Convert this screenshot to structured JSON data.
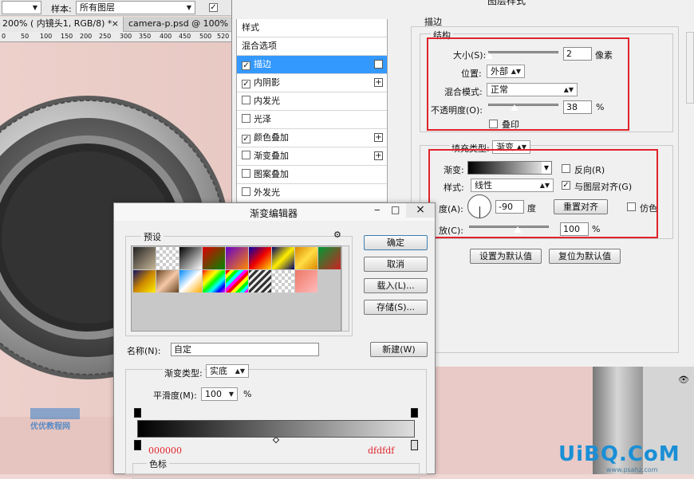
{
  "toolbar": {
    "first_dropdown": "",
    "sample_label": "样本:",
    "sample_value": "所有图层"
  },
  "tabs": [
    {
      "label": "200% ( 内镜头1, RGB/8) *"
    },
    {
      "label": "camera-p.psd @ 100% ("
    }
  ],
  "ruler": [
    "0",
    "50",
    "100",
    "150",
    "200",
    "250",
    "300",
    "350",
    "400",
    "450",
    "500",
    "520"
  ],
  "layer_style": {
    "title": "图层样式",
    "styles_header": "样式",
    "items": [
      {
        "label": "混合选项",
        "checkbox": false,
        "checked": false,
        "plus": false,
        "selected": false
      },
      {
        "label": "描边",
        "checkbox": true,
        "checked": true,
        "plus": true,
        "selected": true
      },
      {
        "label": "内阴影",
        "checkbox": true,
        "checked": true,
        "plus": true,
        "selected": false
      },
      {
        "label": "内发光",
        "checkbox": true,
        "checked": false,
        "plus": false,
        "selected": false
      },
      {
        "label": "光泽",
        "checkbox": true,
        "checked": false,
        "plus": false,
        "selected": false
      },
      {
        "label": "颜色叠加",
        "checkbox": true,
        "checked": true,
        "plus": true,
        "selected": false
      },
      {
        "label": "渐变叠加",
        "checkbox": true,
        "checked": false,
        "plus": true,
        "selected": false
      },
      {
        "label": "图案叠加",
        "checkbox": true,
        "checked": false,
        "plus": false,
        "selected": false
      },
      {
        "label": "外发光",
        "checkbox": true,
        "checked": false,
        "plus": false,
        "selected": false
      }
    ],
    "stroke": {
      "section_title": "描边",
      "structure_title": "结构",
      "size_label": "大小(S):",
      "size_value": "2",
      "size_unit": "像素",
      "size_level": 0.02,
      "position_label": "位置:",
      "position_value": "外部",
      "blend_label": "混合模式:",
      "blend_value": "正常",
      "opacity_label": "不透明度(O):",
      "opacity_value": "38",
      "opacity_unit": "%",
      "opacity_level": 0.38,
      "overprint_label": "叠印",
      "fill_type_label": "填充类型:",
      "fill_type_value": "渐变",
      "gradient_label": "渐变:",
      "reverse_label": "反向(R)",
      "style_label": "样式:",
      "style_value": "线性",
      "align_label": "与图层对齐(G)",
      "angle_label": "度(A):",
      "angle_value": "-90",
      "angle_unit": "度",
      "reset_align_label": "重置对齐",
      "dither_label": "仿色",
      "scale_label": "放(C):",
      "scale_value": "100",
      "scale_unit": "%",
      "scale_level": 0.5
    },
    "set_default_label": "设置为默认值",
    "reset_default_label": "复位为默认值"
  },
  "gradient_editor": {
    "title": "渐变编辑器",
    "presets_label": "预设",
    "ok_label": "确定",
    "cancel_label": "取消",
    "load_label": "载入(L)...",
    "save_label": "存储(S)...",
    "name_label": "名称(N):",
    "name_value": "自定",
    "new_label": "新建(W)",
    "type_label": "渐变类型:",
    "type_value": "实底",
    "smoothness_label": "平滑度(M):",
    "smoothness_value": "100",
    "smoothness_unit": "%",
    "left_color": "000000",
    "right_color": "dfdfdf",
    "stops_label": "色标"
  },
  "watermark": {
    "text": "UiBQ.CoM",
    "subtext": "www.psahz.com",
    "left_subtext": "优优教程网"
  },
  "colors": {
    "accent": "#3399ff",
    "highlight_box": "#e0232b",
    "stop_text": "#e0232b",
    "watermark": "#1a8fd6"
  }
}
